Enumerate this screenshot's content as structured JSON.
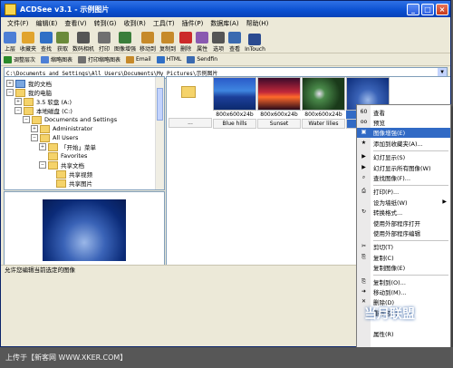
{
  "window": {
    "title": "ACDSee v3.1 - 示例图片"
  },
  "menu": [
    "文件(F)",
    "编辑(E)",
    "查看(V)",
    "转到(G)",
    "收到(R)",
    "工具(T)",
    "插件(P)",
    "数据库(A)",
    "帮助(H)"
  ],
  "toolbar": [
    {
      "label": "上层",
      "icon": "up-icon",
      "color": "#4d7fd6"
    },
    {
      "label": "收藏夹",
      "icon": "favorites-icon",
      "color": "#e1a42d"
    },
    {
      "label": "查找",
      "icon": "find-icon",
      "color": "#2f6fc6"
    },
    {
      "label": "获取",
      "icon": "acquire-icon",
      "color": "#6a8a3a"
    },
    {
      "label": "数码相机",
      "icon": "camera-icon",
      "color": "#555"
    },
    {
      "label": "打印",
      "icon": "print-icon",
      "color": "#707070"
    },
    {
      "label": "图像增强",
      "icon": "enhance-icon",
      "color": "#3b7e3b"
    },
    {
      "label": "移动到",
      "icon": "move-icon",
      "color": "#c68a2a"
    },
    {
      "label": "复制到",
      "icon": "copy-icon",
      "color": "#c68a2a"
    },
    {
      "label": "删除",
      "icon": "delete-icon",
      "color": "#cc2a2a"
    },
    {
      "label": "属性",
      "icon": "properties-icon",
      "color": "#8a5ab0"
    },
    {
      "label": "选项",
      "icon": "options-icon",
      "color": "#555"
    },
    {
      "label": "查看",
      "icon": "view-icon",
      "color": "#3a6ab0"
    },
    {
      "label": "InTouch",
      "icon": "intouch-icon",
      "color": "#2a4a90"
    }
  ],
  "toolbar2": [
    {
      "label": "调整层次",
      "color": "#2a8a2a"
    },
    {
      "label": "缩略图表",
      "color": "#4d7fd6"
    },
    {
      "label": "打印缩略图表",
      "color": "#707070"
    },
    {
      "label": "Email",
      "color": "#c68a2a"
    },
    {
      "label": "HTML",
      "color": "#2f6fc6"
    },
    {
      "label": "Sendfin",
      "color": "#3a6ab0"
    }
  ],
  "address": "C:\\Documents and Settings\\All Users\\Documents\\My Pictures\\示例图片",
  "tree": [
    {
      "label": "我的文档",
      "depth": 0,
      "pm": "+",
      "type": "doc"
    },
    {
      "label": "我的电脑",
      "depth": 0,
      "pm": "−",
      "type": "folder"
    },
    {
      "label": "3.5 软盘 (A:)",
      "depth": 1,
      "pm": "+",
      "type": "folder"
    },
    {
      "label": "本地磁盘 (C:)",
      "depth": 1,
      "pm": "−",
      "type": "folder"
    },
    {
      "label": "Documents and Settings",
      "depth": 2,
      "pm": "−",
      "type": "folder"
    },
    {
      "label": "Administrator",
      "depth": 3,
      "pm": "+",
      "type": "folder"
    },
    {
      "label": "All Users",
      "depth": 3,
      "pm": "−",
      "type": "folder"
    },
    {
      "label": "「开始」菜单",
      "depth": 4,
      "pm": "+",
      "type": "folder"
    },
    {
      "label": "Favorites",
      "depth": 4,
      "pm": "",
      "type": "folder"
    },
    {
      "label": "共享文档",
      "depth": 4,
      "pm": "−",
      "type": "folder"
    },
    {
      "label": "共享视频",
      "depth": 5,
      "pm": "",
      "type": "folder"
    },
    {
      "label": "共享图片",
      "depth": 5,
      "pm": "",
      "type": "folder"
    }
  ],
  "thumbnails": [
    {
      "info": "...",
      "name": "",
      "kind": "folder",
      "selected": false
    },
    {
      "info": "800x600x24b",
      "name": "Blue hills",
      "kind": "hills",
      "selected": false
    },
    {
      "info": "800x600x24b",
      "name": "Sunset",
      "kind": "sunset",
      "selected": false
    },
    {
      "info": "800x600x24b",
      "name": "Water lilies",
      "kind": "lilies",
      "selected": false
    },
    {
      "info": "800x",
      "name": "Wi",
      "kind": "winter",
      "selected": true
    }
  ],
  "statusbar": "允许您编辑当前选定的图像",
  "context_menu": [
    {
      "label": "查看",
      "icon": "view-icon",
      "glyph": "60",
      "sep": false,
      "hl": false
    },
    {
      "label": "预览",
      "icon": "preview-icon",
      "glyph": "oo",
      "sep": false,
      "hl": false
    },
    {
      "label": "图像增强(E)",
      "icon": "enhance-icon",
      "glyph": "▣",
      "sep": false,
      "hl": true
    },
    {
      "label": "添加到收藏夹(A)...",
      "icon": "add-favorites-icon",
      "glyph": "★",
      "sep": true,
      "hl": false
    },
    {
      "label": "幻灯显示(S)",
      "icon": "slideshow-icon",
      "glyph": "▶",
      "sep": false,
      "hl": false
    },
    {
      "label": "幻灯显示所有图像(W)",
      "icon": "slideshow-all-icon",
      "glyph": "▶",
      "sep": false,
      "hl": false
    },
    {
      "label": "查找图像(F)...",
      "icon": "find-icon",
      "glyph": "⌕",
      "sep": true,
      "hl": false
    },
    {
      "label": "打印(P)...",
      "icon": "print-icon",
      "glyph": "⎙",
      "sep": false,
      "hl": false
    },
    {
      "label": "设为墙纸(W)",
      "icon": "wallpaper-icon",
      "glyph": "",
      "sep": false,
      "hl": false,
      "arrow": true
    },
    {
      "label": "转换格式...",
      "icon": "convert-icon",
      "glyph": "↻",
      "sep": false,
      "hl": false
    },
    {
      "label": "使用外部程序打开",
      "icon": "open-external-icon",
      "glyph": "",
      "sep": false,
      "hl": false
    },
    {
      "label": "使用外部程序编辑",
      "icon": "edit-external-icon",
      "glyph": "",
      "sep": true,
      "hl": false
    },
    {
      "label": "剪切(T)",
      "icon": "cut-icon",
      "glyph": "✂",
      "sep": false,
      "hl": false
    },
    {
      "label": "复制(C)",
      "icon": "copy-icon",
      "glyph": "⎘",
      "sep": false,
      "hl": false
    },
    {
      "label": "复制图像(E)",
      "icon": "copy-image-icon",
      "glyph": "",
      "sep": true,
      "hl": false
    },
    {
      "label": "复制到(O)...",
      "icon": "copy-to-icon",
      "glyph": "⎘",
      "sep": false,
      "hl": false
    },
    {
      "label": "移动到(M)...",
      "icon": "move-to-icon",
      "glyph": "➜",
      "sep": false,
      "hl": false
    },
    {
      "label": "删除(D)",
      "icon": "delete-icon",
      "glyph": "✕",
      "sep": false,
      "hl": false
    },
    {
      "label": "重命名(N)",
      "icon": "rename-icon",
      "glyph": "",
      "sep": false,
      "hl": false
    },
    {
      "label": "",
      "icon": "",
      "glyph": "",
      "sep": false,
      "hl": false
    },
    {
      "label": "属性(R)",
      "icon": "properties-icon",
      "glyph": "",
      "sep": false,
      "hl": false
    }
  ],
  "footer": "上传于【新客网 WWW.XKER.COM】",
  "watermark": {
    "text": "当月联盟",
    "sub": "www.5yoo.com"
  }
}
